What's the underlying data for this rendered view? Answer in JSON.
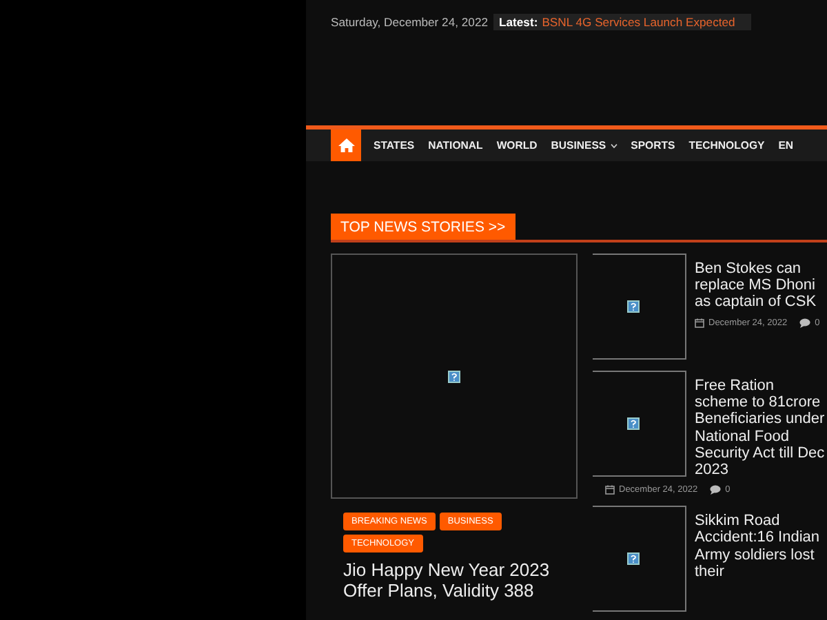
{
  "top_bar": {
    "date": "Saturday, December 24, 2022",
    "latest_label": "Latest:",
    "latest_headline": "BSNL 4G Services Launch Expected"
  },
  "nav": {
    "items": [
      {
        "kind": "home",
        "selected": true,
        "dropdown": false
      },
      {
        "kind": "link",
        "label": "STATES",
        "selected": false,
        "dropdown": false
      },
      {
        "kind": "link",
        "label": "NATIONAL",
        "selected": false,
        "dropdown": false
      },
      {
        "kind": "link",
        "label": "WORLD",
        "selected": false,
        "dropdown": false
      },
      {
        "kind": "link",
        "label": "BUSINESS",
        "selected": false,
        "dropdown": true
      },
      {
        "kind": "link",
        "label": "SPORTS",
        "selected": false,
        "dropdown": false
      },
      {
        "kind": "link",
        "label": "TECHNOLOGY",
        "selected": false,
        "dropdown": false
      },
      {
        "kind": "link",
        "label": "EN",
        "selected": false,
        "dropdown": false
      }
    ]
  },
  "section": {
    "title": "TOP NEWS STORIES >>"
  },
  "featured": {
    "tags": [
      "BREAKING NEWS",
      "BUSINESS",
      "TECHNOLOGY"
    ],
    "title": "Jio Happy New Year 2023 Offer Plans, Validity 388"
  },
  "side_stories": [
    {
      "title": "Ben Stokes can replace MS Dhoni as captain of CSK",
      "date": "December 24, 2022",
      "comments": "0"
    },
    {
      "title": "Free Ration scheme to 81crore Beneficiaries under National Food Security Act till Dec 2023",
      "date": "December 24, 2022",
      "comments": "0"
    },
    {
      "title": "Sikkim Road Accident:16 Indian Army soldiers lost their"
    }
  ]
}
